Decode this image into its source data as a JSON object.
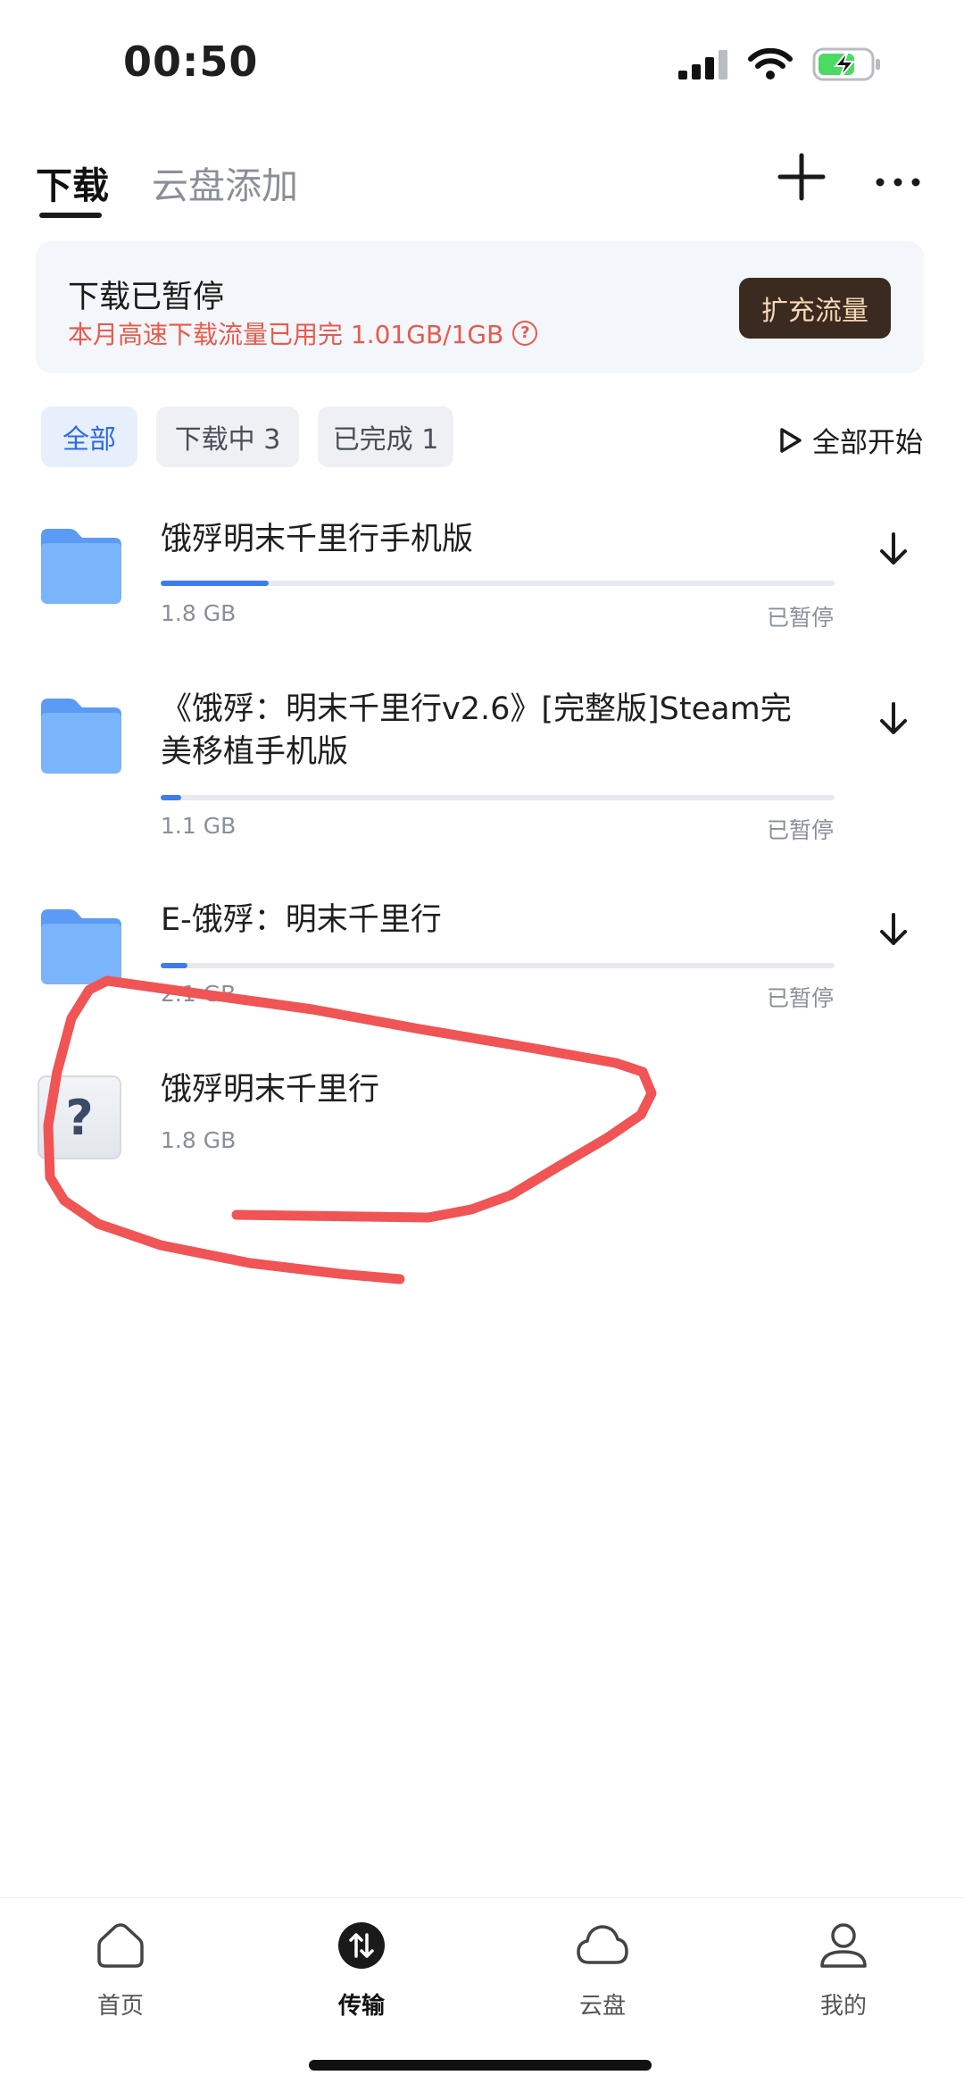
{
  "status_bar": {
    "time": "00:50"
  },
  "header": {
    "tabs": [
      "下载",
      "云盘添加"
    ]
  },
  "banner": {
    "title": "下载已暂停",
    "subtitle": "本月高速下载流量已用完 1.01GB/1GB",
    "button": "扩充流量"
  },
  "filters": {
    "all": "全部",
    "downloading": "下载中 3",
    "done": "已完成 1",
    "start_all": "全部开始"
  },
  "items": [
    {
      "title": "饿殍明末千里行手机版",
      "size": "1.8 GB",
      "status": "已暂停",
      "progress": 0.16
    },
    {
      "title": "《饿殍：明末千里行v2.6》[完整版]Steam完美移植手机版",
      "size": "1.1 GB",
      "status": "已暂停",
      "progress": 0.03
    },
    {
      "title": "E-饿殍：明末千里行",
      "size": "2.1 GB",
      "status": "已暂停",
      "progress": 0.04
    },
    {
      "title": "饿殍明末千里行",
      "size": "1.8 GB"
    }
  ],
  "bottom_nav": [
    "首页",
    "传输",
    "云盘",
    "我的"
  ],
  "colors": {
    "accent": "#3d7cf0",
    "warning": "#e85a4a",
    "annotation": "#f05454"
  }
}
